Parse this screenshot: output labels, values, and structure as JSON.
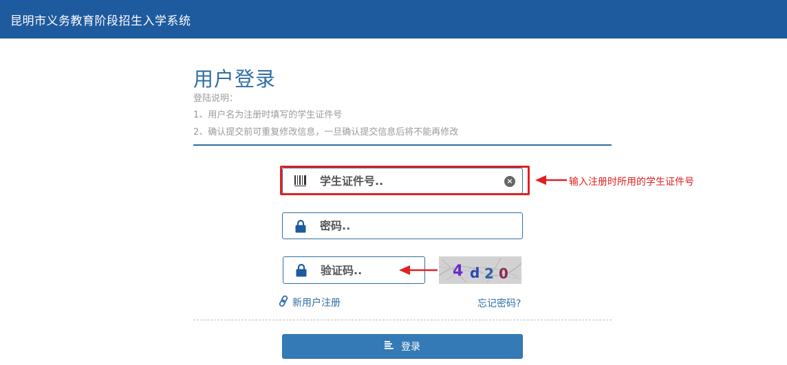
{
  "header": {
    "title": "昆明市义务教育阶段招生入学系统"
  },
  "login": {
    "title": "用户登录",
    "notes_heading": "登陆说明：",
    "notes": [
      "1、用户名为注册时填写的学生证件号",
      "2、确认提交前可重复修改信息，一旦确认提交信息后将不能再修改"
    ]
  },
  "form": {
    "id_placeholder": "学生证件号..",
    "password_placeholder": "密码..",
    "captcha_placeholder": "验证码..",
    "captcha_chars": [
      "4",
      "d",
      "2",
      "0"
    ],
    "register_link": "新用户注册",
    "forgot_link": "忘记密码?",
    "login_button": "登录"
  },
  "annotation": {
    "text": "输入注册时所用的学生证件号"
  },
  "colors": {
    "header_bg": "#1e5a9e",
    "accent": "#2e6da4",
    "button": "#347ab7",
    "annotation": "#e02020"
  }
}
